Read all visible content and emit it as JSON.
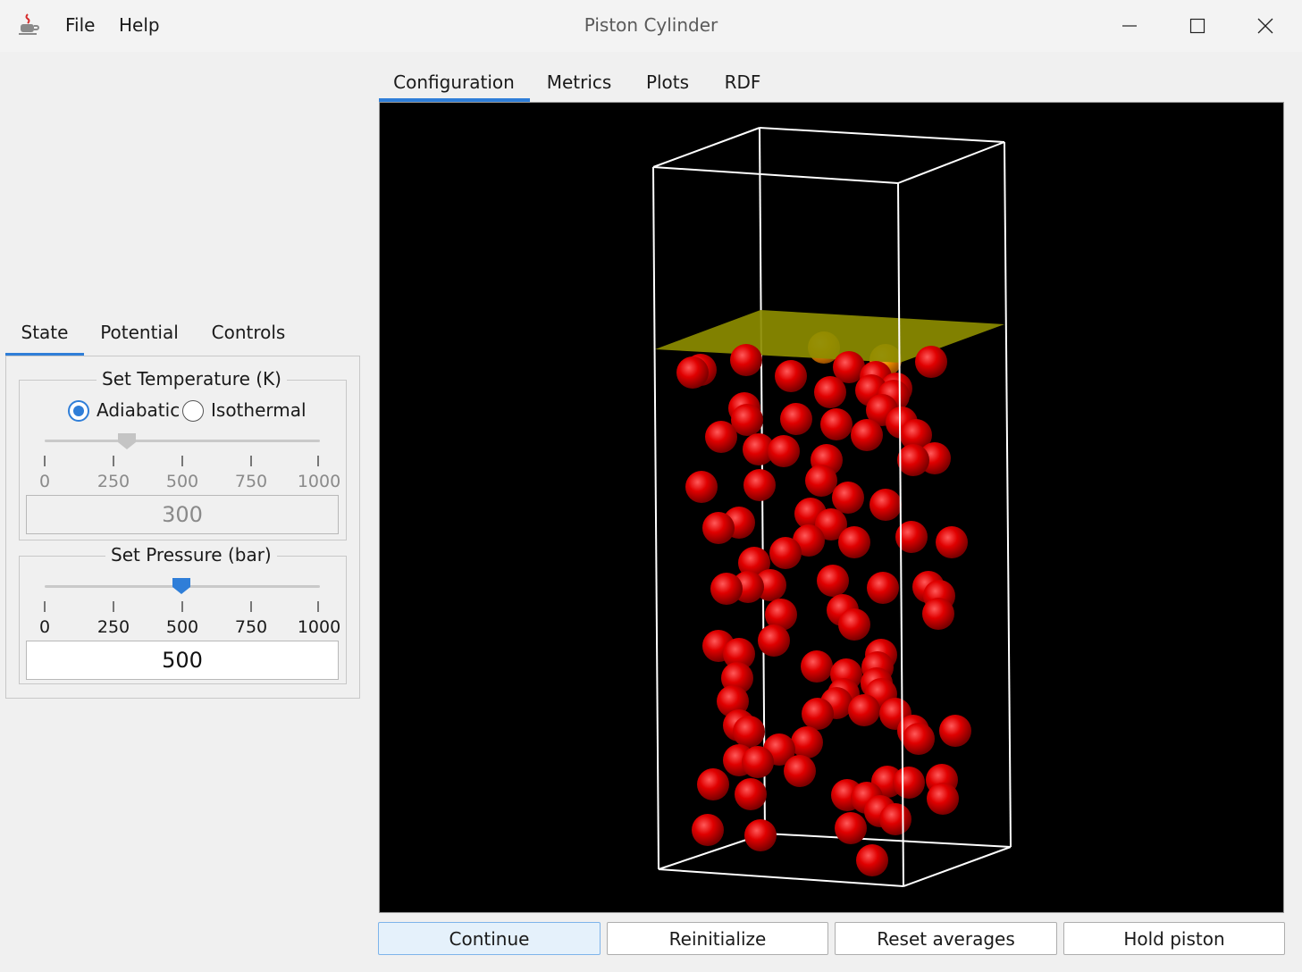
{
  "window": {
    "title": "Piston Cylinder",
    "menu": [
      "File",
      "Help"
    ],
    "app_icon": "java-cup-icon"
  },
  "main_tabs": [
    "Configuration",
    "Metrics",
    "Plots",
    "RDF"
  ],
  "left_tabs": [
    "State",
    "Potential",
    "Controls"
  ],
  "temperature": {
    "title": "Set Temperature (K)",
    "modes": [
      "Adiabatic",
      "Isothermal"
    ],
    "selected_mode": "Adiabatic",
    "ticks": [
      "0",
      "250",
      "500",
      "750",
      "1000"
    ],
    "value": "300",
    "slider_fraction": 0.3,
    "enabled": false
  },
  "pressure": {
    "title": "Set Pressure (bar)",
    "ticks": [
      "0",
      "250",
      "500",
      "750",
      "1000"
    ],
    "value": "500",
    "slider_fraction": 0.5,
    "enabled": true
  },
  "buttons": [
    "Continue",
    "Reinitialize",
    "Reset averages",
    "Hold piston"
  ],
  "colors": {
    "accent": "#2f7ed8",
    "atom": "#e00000",
    "piston": "#8c8c00",
    "box_edges": "#ffffff",
    "viewport_bg": "#000000"
  }
}
